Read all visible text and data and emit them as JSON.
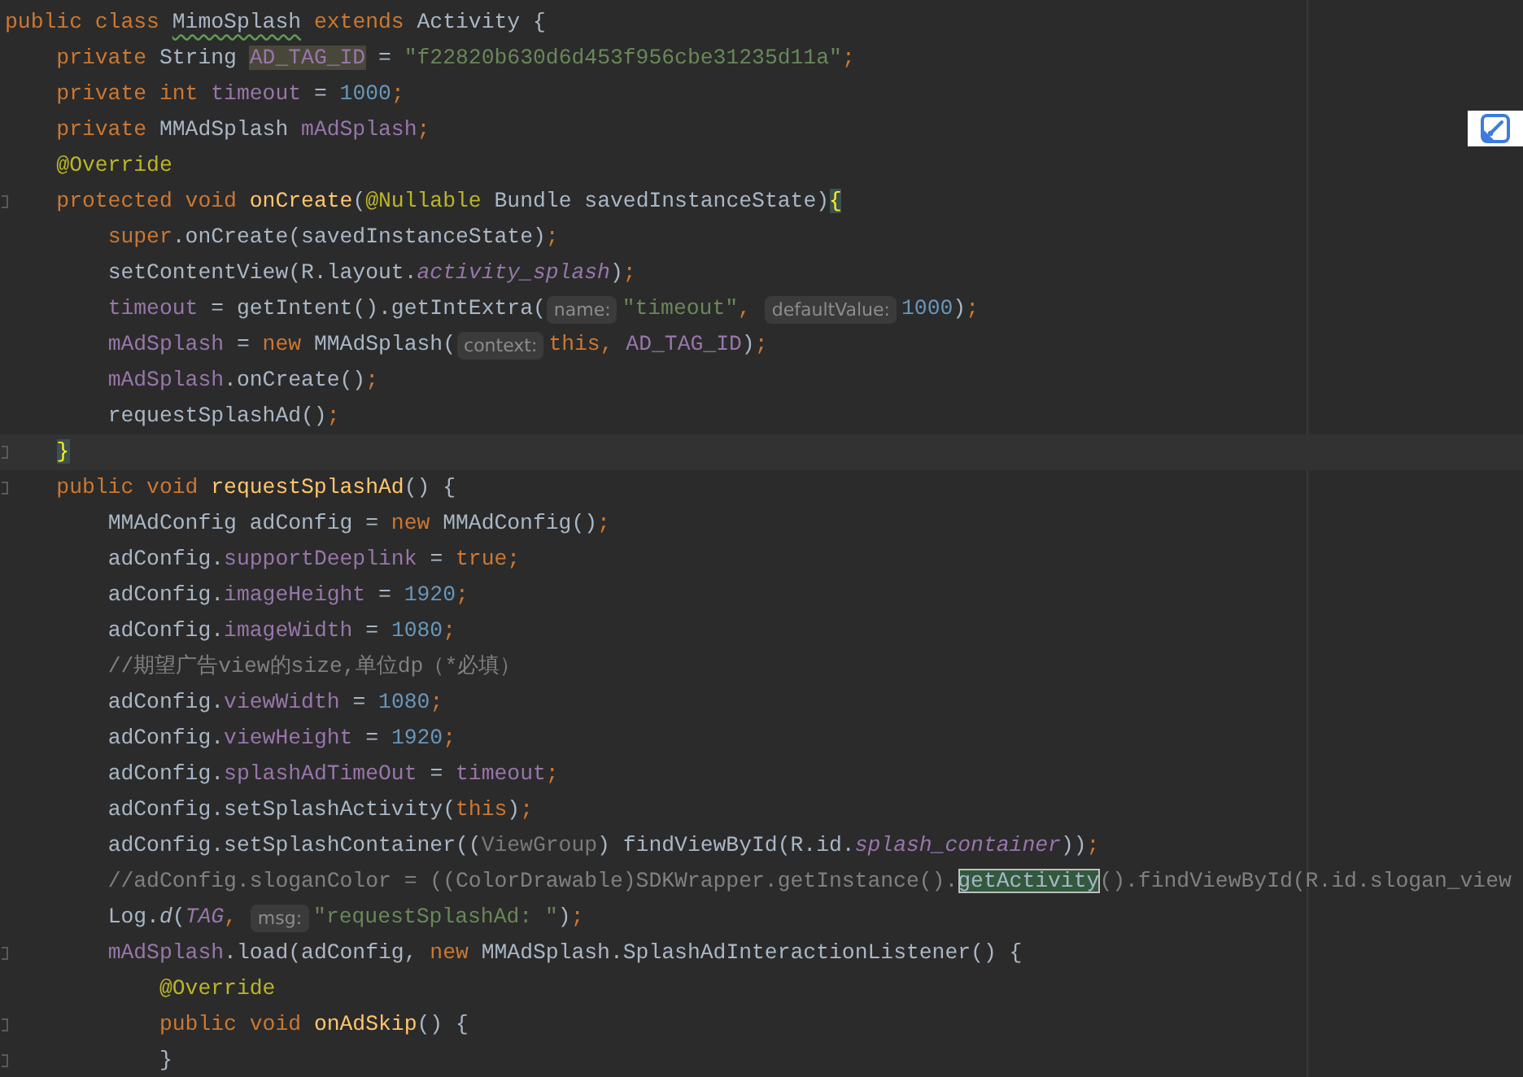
{
  "editor": {
    "lines": [
      {
        "current": false,
        "fold": false,
        "tokens": [
          {
            "text": "public class ",
            "kind": "keyword"
          },
          {
            "text": "MimoSplash",
            "kind": "typo"
          },
          {
            "text": " extends ",
            "kind": "keyword"
          },
          {
            "text": "Activity {",
            "kind": "plain"
          }
        ]
      },
      {
        "current": false,
        "fold": false,
        "tokens": [
          {
            "text": "    private ",
            "kind": "keyword"
          },
          {
            "text": "String ",
            "kind": "plain"
          },
          {
            "text": "AD_TAG_ID",
            "kind": "usage"
          },
          {
            "text": " = ",
            "kind": "plain"
          },
          {
            "text": "\"f22820b630d6d453f956cbe31235d11a\"",
            "kind": "string"
          },
          {
            "text": ";",
            "kind": "keyword"
          }
        ]
      },
      {
        "current": false,
        "fold": false,
        "tokens": [
          {
            "text": "    private int ",
            "kind": "keyword"
          },
          {
            "text": "timeout",
            "kind": "field"
          },
          {
            "text": " = ",
            "kind": "plain"
          },
          {
            "text": "1000",
            "kind": "number"
          },
          {
            "text": ";",
            "kind": "keyword"
          }
        ]
      },
      {
        "current": false,
        "fold": false,
        "tokens": [
          {
            "text": "    private ",
            "kind": "keyword"
          },
          {
            "text": "MMAdSplash ",
            "kind": "plain"
          },
          {
            "text": "mAdSplash",
            "kind": "field"
          },
          {
            "text": ";",
            "kind": "keyword"
          }
        ]
      },
      {
        "current": false,
        "fold": false,
        "tokens": [
          {
            "text": "    @Override",
            "kind": "annotation"
          }
        ]
      },
      {
        "current": false,
        "fold": true,
        "tokens": [
          {
            "text": "    protected void ",
            "kind": "keyword"
          },
          {
            "text": "onCreate",
            "kind": "declaration"
          },
          {
            "text": "(",
            "kind": "plain"
          },
          {
            "text": "@Nullable",
            "kind": "annotation"
          },
          {
            "text": " Bundle savedInstanceState)",
            "kind": "plain"
          },
          {
            "text": "{",
            "kind": "brace"
          }
        ]
      },
      {
        "current": false,
        "fold": false,
        "tokens": [
          {
            "text": "        super",
            "kind": "keyword"
          },
          {
            "text": ".onCreate(savedInstanceState)",
            "kind": "plain"
          },
          {
            "text": ";",
            "kind": "keyword"
          }
        ]
      },
      {
        "current": false,
        "fold": false,
        "tokens": [
          {
            "text": "        setContentView(R.layout.",
            "kind": "plain"
          },
          {
            "text": "activity_splash",
            "kind": "static"
          },
          {
            "text": ")",
            "kind": "plain"
          },
          {
            "text": ";",
            "kind": "keyword"
          }
        ]
      },
      {
        "current": false,
        "fold": false,
        "tokens": [
          {
            "text": "        timeout",
            "kind": "field"
          },
          {
            "text": " = getIntent().getIntExtra(",
            "kind": "plain"
          },
          {
            "text": "name:",
            "kind": "hint"
          },
          {
            "text": "\"timeout\"",
            "kind": "string"
          },
          {
            "text": ", ",
            "kind": "keyword"
          },
          {
            "text": "defaultValue:",
            "kind": "hint"
          },
          {
            "text": "1000",
            "kind": "number"
          },
          {
            "text": ")",
            "kind": "plain"
          },
          {
            "text": ";",
            "kind": "keyword"
          }
        ]
      },
      {
        "current": false,
        "fold": false,
        "tokens": [
          {
            "text": "        mAdSplash",
            "kind": "field"
          },
          {
            "text": " = ",
            "kind": "plain"
          },
          {
            "text": "new ",
            "kind": "keyword"
          },
          {
            "text": "MMAdSplash(",
            "kind": "plain"
          },
          {
            "text": "context:",
            "kind": "hint"
          },
          {
            "text": "this, ",
            "kind": "keyword"
          },
          {
            "text": "AD_TAG_ID",
            "kind": "field"
          },
          {
            "text": ")",
            "kind": "plain"
          },
          {
            "text": ";",
            "kind": "keyword"
          }
        ]
      },
      {
        "current": false,
        "fold": false,
        "tokens": [
          {
            "text": "        mAdSplash",
            "kind": "field"
          },
          {
            "text": ".onCreate()",
            "kind": "plain"
          },
          {
            "text": ";",
            "kind": "keyword"
          }
        ]
      },
      {
        "current": false,
        "fold": false,
        "tokens": [
          {
            "text": "        requestSplashAd()",
            "kind": "plain"
          },
          {
            "text": ";",
            "kind": "keyword"
          }
        ]
      },
      {
        "current": true,
        "fold": true,
        "tokens": [
          {
            "text": "    }",
            "kind": "brace"
          }
        ]
      },
      {
        "current": false,
        "fold": true,
        "tokens": [
          {
            "text": "    public void ",
            "kind": "keyword"
          },
          {
            "text": "requestSplashAd",
            "kind": "declaration"
          },
          {
            "text": "() {",
            "kind": "plain"
          }
        ]
      },
      {
        "current": false,
        "fold": false,
        "tokens": [
          {
            "text": "        MMAdConfig adConfig = ",
            "kind": "plain"
          },
          {
            "text": "new ",
            "kind": "keyword"
          },
          {
            "text": "MMAdConfig()",
            "kind": "plain"
          },
          {
            "text": ";",
            "kind": "keyword"
          }
        ]
      },
      {
        "current": false,
        "fold": false,
        "tokens": [
          {
            "text": "        adConfig.",
            "kind": "plain"
          },
          {
            "text": "supportDeeplink",
            "kind": "field"
          },
          {
            "text": " = ",
            "kind": "plain"
          },
          {
            "text": "true;",
            "kind": "keyword"
          }
        ]
      },
      {
        "current": false,
        "fold": false,
        "tokens": [
          {
            "text": "        adConfig.",
            "kind": "plain"
          },
          {
            "text": "imageHeight",
            "kind": "field"
          },
          {
            "text": " = ",
            "kind": "plain"
          },
          {
            "text": "1920",
            "kind": "number"
          },
          {
            "text": ";",
            "kind": "keyword"
          }
        ]
      },
      {
        "current": false,
        "fold": false,
        "tokens": [
          {
            "text": "        adConfig.",
            "kind": "plain"
          },
          {
            "text": "imageWidth",
            "kind": "field"
          },
          {
            "text": " = ",
            "kind": "plain"
          },
          {
            "text": "1080",
            "kind": "number"
          },
          {
            "text": ";",
            "kind": "keyword"
          }
        ]
      },
      {
        "current": false,
        "fold": false,
        "tokens": [
          {
            "text": "        //期望广告view的size,单位dp（*必填）",
            "kind": "comment"
          }
        ]
      },
      {
        "current": false,
        "fold": false,
        "tokens": [
          {
            "text": "        adConfig.",
            "kind": "plain"
          },
          {
            "text": "viewWidth",
            "kind": "field"
          },
          {
            "text": " = ",
            "kind": "plain"
          },
          {
            "text": "1080",
            "kind": "number"
          },
          {
            "text": ";",
            "kind": "keyword"
          }
        ]
      },
      {
        "current": false,
        "fold": false,
        "tokens": [
          {
            "text": "        adConfig.",
            "kind": "plain"
          },
          {
            "text": "viewHeight",
            "kind": "field"
          },
          {
            "text": " = ",
            "kind": "plain"
          },
          {
            "text": "1920",
            "kind": "number"
          },
          {
            "text": ";",
            "kind": "keyword"
          }
        ]
      },
      {
        "current": false,
        "fold": false,
        "tokens": [
          {
            "text": "        adConfig.",
            "kind": "plain"
          },
          {
            "text": "splashAdTimeOut",
            "kind": "field"
          },
          {
            "text": " = ",
            "kind": "plain"
          },
          {
            "text": "timeout",
            "kind": "field"
          },
          {
            "text": ";",
            "kind": "keyword"
          }
        ]
      },
      {
        "current": false,
        "fold": false,
        "tokens": [
          {
            "text": "        adConfig.setSplashActivity(",
            "kind": "plain"
          },
          {
            "text": "this",
            "kind": "keyword"
          },
          {
            "text": ")",
            "kind": "plain"
          },
          {
            "text": ";",
            "kind": "keyword"
          }
        ]
      },
      {
        "current": false,
        "fold": false,
        "tokens": [
          {
            "text": "        adConfig.setSplashContainer((",
            "kind": "plain"
          },
          {
            "text": "ViewGroup",
            "kind": "unused"
          },
          {
            "text": ") findViewById(R.id.",
            "kind": "plain"
          },
          {
            "text": "splash_container",
            "kind": "static"
          },
          {
            "text": "))",
            "kind": "plain"
          },
          {
            "text": ";",
            "kind": "keyword"
          }
        ]
      },
      {
        "current": false,
        "fold": false,
        "tokens": [
          {
            "text": "        //adConfig.sloganColor = ((ColorDrawable)SDKWrapper.getInstance().",
            "kind": "comment"
          },
          {
            "text": "getActivity",
            "kind": "match"
          },
          {
            "text": "().findViewById(R.id.slogan_view",
            "kind": "comment"
          }
        ]
      },
      {
        "current": false,
        "fold": false,
        "tokens": [
          {
            "text": "        Log.",
            "kind": "plain"
          },
          {
            "text": "d",
            "kind": "italic"
          },
          {
            "text": "(",
            "kind": "plain"
          },
          {
            "text": "TAG",
            "kind": "static"
          },
          {
            "text": ", ",
            "kind": "keyword"
          },
          {
            "text": "msg:",
            "kind": "hint"
          },
          {
            "text": "\"requestSplashAd: \"",
            "kind": "string"
          },
          {
            "text": ")",
            "kind": "plain"
          },
          {
            "text": ";",
            "kind": "keyword"
          }
        ]
      },
      {
        "current": false,
        "fold": true,
        "tokens": [
          {
            "text": "        mAdSplash",
            "kind": "field"
          },
          {
            "text": ".load(adConfig, ",
            "kind": "plain"
          },
          {
            "text": "new ",
            "kind": "keyword"
          },
          {
            "text": "MMAdSplash.SplashAdInteractionListener() {",
            "kind": "plain"
          }
        ]
      },
      {
        "current": false,
        "fold": false,
        "tokens": [
          {
            "text": "            @Override",
            "kind": "annotation"
          }
        ]
      },
      {
        "current": false,
        "fold": true,
        "tokens": [
          {
            "text": "            public void ",
            "kind": "keyword"
          },
          {
            "text": "onAdSkip",
            "kind": "declaration"
          },
          {
            "text": "() {",
            "kind": "plain"
          }
        ]
      },
      {
        "current": false,
        "fold": true,
        "tokens": [
          {
            "text": "            }",
            "kind": "plain"
          }
        ]
      }
    ]
  }
}
